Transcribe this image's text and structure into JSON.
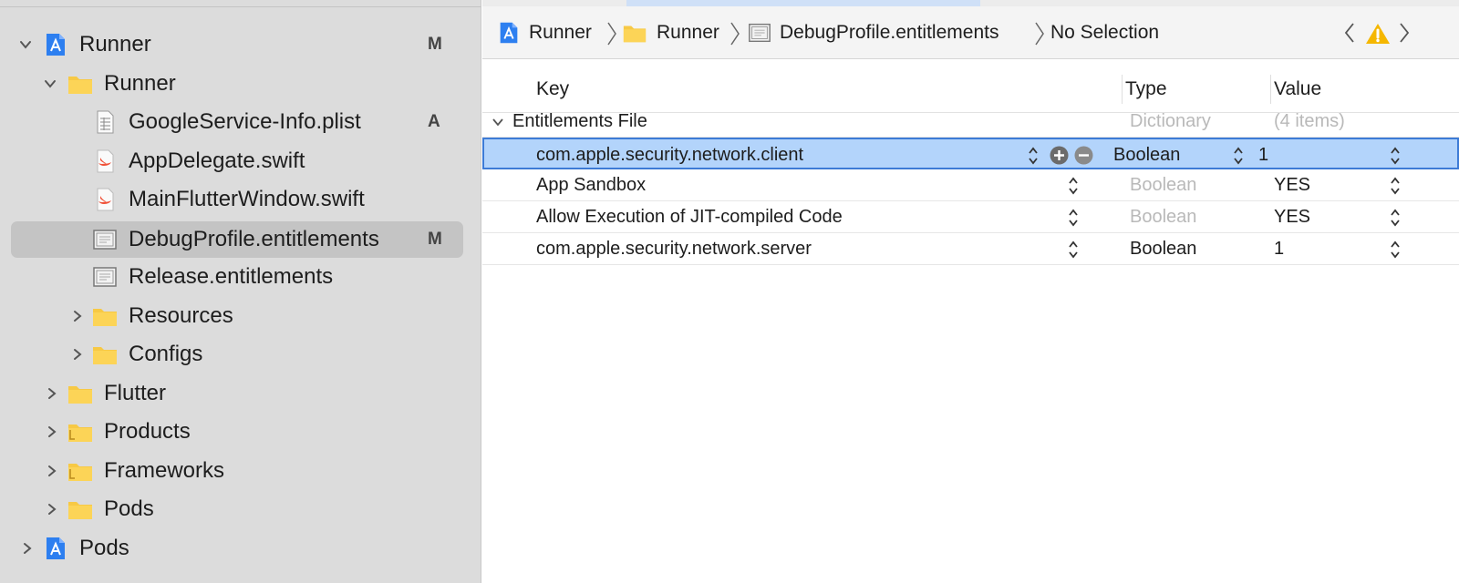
{
  "navigator": {
    "items": [
      {
        "label": "Runner",
        "badge": "M",
        "icon": "xcode-project-icon",
        "expanded": true
      },
      {
        "label": "Runner",
        "badge": "",
        "icon": "folder-icon",
        "expanded": true
      },
      {
        "label": "GoogleService-Info.plist",
        "badge": "A",
        "icon": "plist-file-icon"
      },
      {
        "label": "AppDelegate.swift",
        "badge": "",
        "icon": "swift-file-icon"
      },
      {
        "label": "MainFlutterWindow.swift",
        "badge": "",
        "icon": "swift-file-icon"
      },
      {
        "label": "DebugProfile.entitlements",
        "badge": "M",
        "icon": "entitlements-file-icon",
        "selected": true
      },
      {
        "label": "Release.entitlements",
        "badge": "",
        "icon": "entitlements-file-icon"
      },
      {
        "label": "Resources",
        "badge": "",
        "icon": "folder-icon",
        "expanded": false
      },
      {
        "label": "Configs",
        "badge": "",
        "icon": "folder-icon",
        "expanded": false
      },
      {
        "label": "Flutter",
        "badge": "",
        "icon": "folder-icon",
        "expanded": false
      },
      {
        "label": "Products",
        "badge": "",
        "icon": "folder-icon",
        "expanded": false
      },
      {
        "label": "Frameworks",
        "badge": "",
        "icon": "folder-icon",
        "expanded": false
      },
      {
        "label": "Pods",
        "badge": "",
        "icon": "folder-icon",
        "expanded": false
      },
      {
        "label": "Pods",
        "badge": "",
        "icon": "xcode-project-icon",
        "expanded": false
      }
    ]
  },
  "jumpbar": {
    "crumbs": [
      "Runner",
      "Runner",
      "DebugProfile.entitlements",
      "No Selection"
    ]
  },
  "plist": {
    "headers": {
      "key": "Key",
      "type": "Type",
      "value": "Value"
    },
    "root": {
      "key": "Entitlements File",
      "type": "Dictionary",
      "value": "(4 items)"
    },
    "rows": [
      {
        "key": "com.apple.security.network.client",
        "type": "Boolean",
        "value": "1"
      },
      {
        "key": "App Sandbox",
        "type": "Boolean",
        "value": "YES"
      },
      {
        "key": "Allow Execution of JIT-compiled Code",
        "type": "Boolean",
        "value": "YES"
      },
      {
        "key": "com.apple.security.network.server",
        "type": "Boolean",
        "value": "1"
      }
    ]
  },
  "colors": {
    "selection": "#b3d4fb",
    "selection_border": "#3d7bd6",
    "folder": "#f7c945",
    "warning": "#f5b700"
  }
}
